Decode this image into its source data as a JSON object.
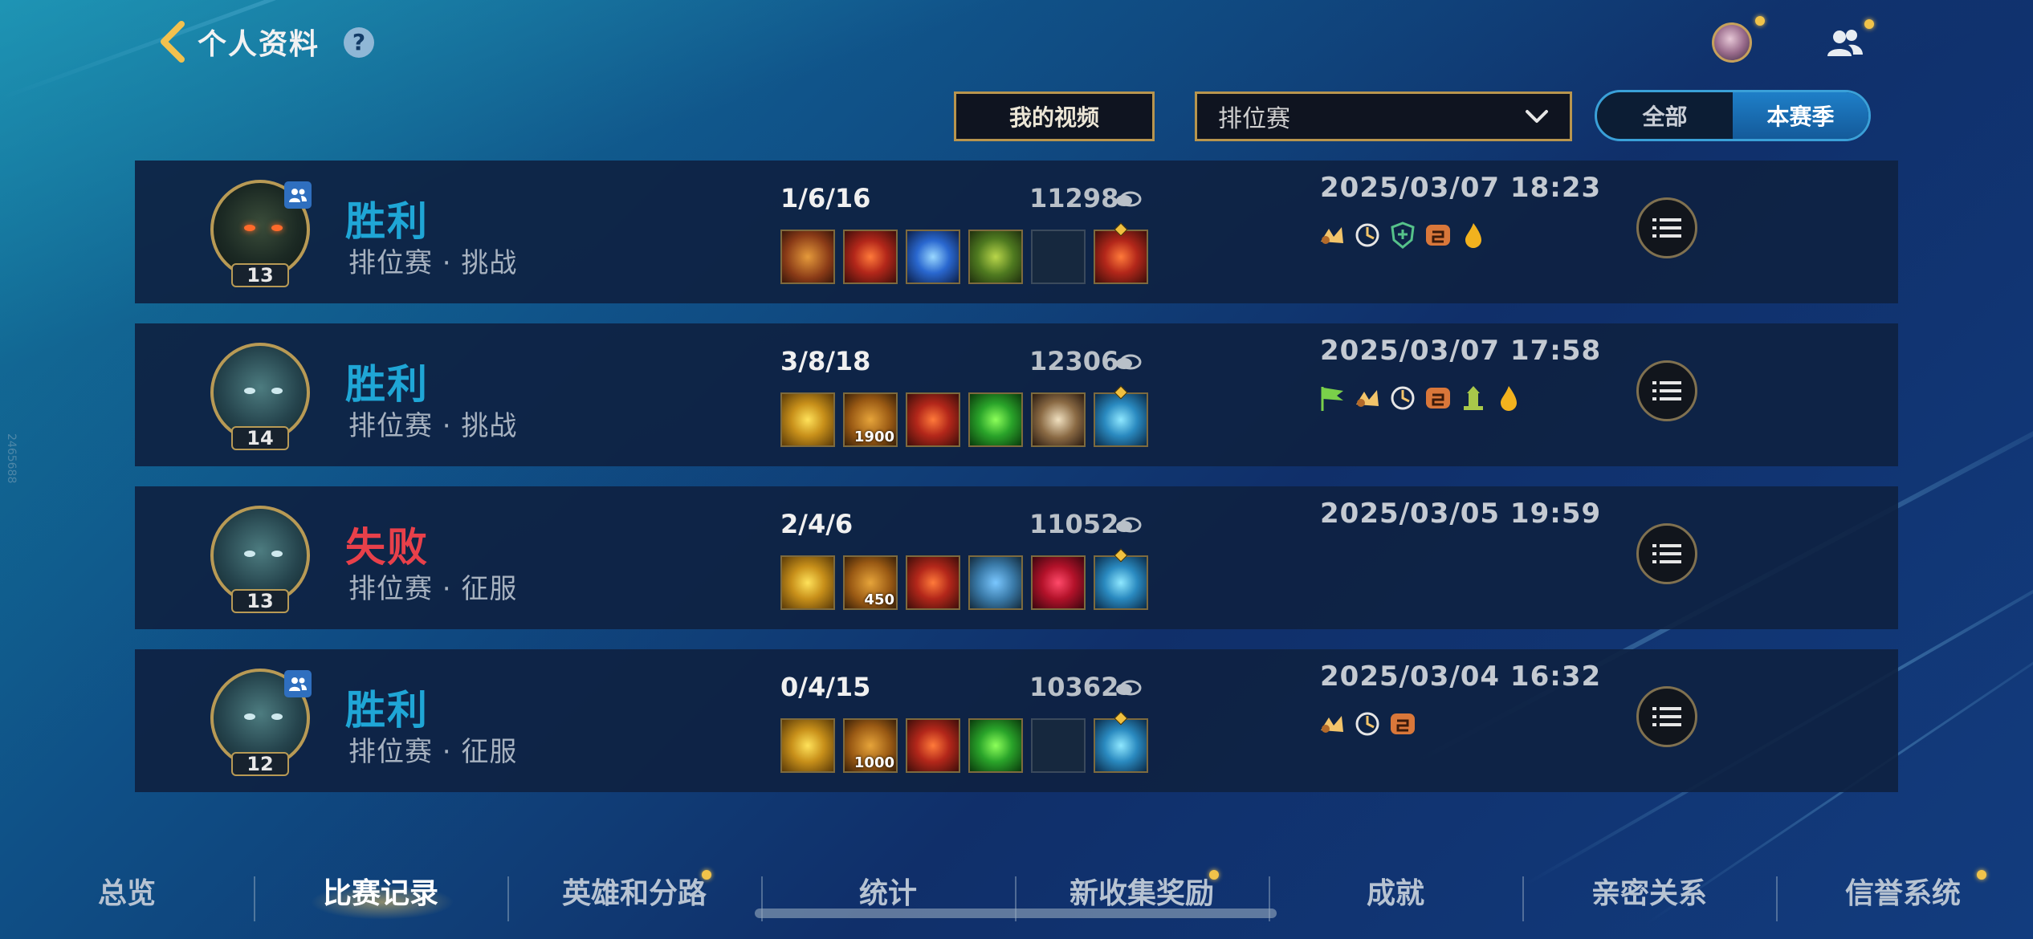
{
  "header": {
    "title": "个人资料",
    "help_icon": "?",
    "side_id": "2465688"
  },
  "filters": {
    "videos_button": "我的视频",
    "queue_selected": "排位赛",
    "season_toggle": {
      "all": "全部",
      "current": "本赛季",
      "active": "current"
    }
  },
  "matches": [
    {
      "level": "13",
      "result": "胜利",
      "result_type": "win",
      "mode": "排位赛 · 挑战",
      "kda": "1/6/16",
      "gold": "11298",
      "date": "2025/03/07 18:23",
      "party": true,
      "items": [
        {
          "icon": "orange-blade-icon",
          "count": ""
        },
        {
          "icon": "red-star-icon",
          "count": ""
        },
        {
          "icon": "blue-crystal-icon",
          "count": ""
        },
        {
          "icon": "green-mask-icon",
          "count": ""
        },
        {
          "icon": "empty-slot",
          "count": ""
        },
        {
          "icon": "red-star-trinket-icon",
          "count": ""
        }
      ],
      "badges": [
        "kill-icon",
        "assist-icon",
        "shield-icon",
        "orange-tag-icon",
        "flame-icon"
      ]
    },
    {
      "level": "14",
      "result": "胜利",
      "result_type": "win",
      "mode": "排位赛 · 挑战",
      "kda": "3/8/18",
      "gold": "12306",
      "date": "2025/03/07 17:58",
      "party": false,
      "items": [
        {
          "icon": "gold-orb-icon",
          "count": ""
        },
        {
          "icon": "map-icon",
          "count": "1900"
        },
        {
          "icon": "red-star-icon",
          "count": ""
        },
        {
          "icon": "lime-orb-icon",
          "count": ""
        },
        {
          "icon": "fist-icon",
          "count": ""
        },
        {
          "icon": "boot-trinket-icon",
          "count": ""
        }
      ],
      "badges": [
        "flag-icon",
        "kill-icon",
        "assist-icon",
        "orange-tag-icon",
        "pillar-icon",
        "flame-icon"
      ]
    },
    {
      "level": "13",
      "result": "失败",
      "result_type": "lose",
      "mode": "排位赛 · 征服",
      "kda": "2/4/6",
      "gold": "11052",
      "date": "2025/03/05 19:59",
      "party": false,
      "items": [
        {
          "icon": "gold-orb-icon",
          "count": ""
        },
        {
          "icon": "map-icon",
          "count": "450"
        },
        {
          "icon": "red-star-icon",
          "count": ""
        },
        {
          "icon": "vest-icon",
          "count": ""
        },
        {
          "icon": "ruby-icon",
          "count": ""
        },
        {
          "icon": "boot-trinket-icon",
          "count": ""
        }
      ],
      "badges": []
    },
    {
      "level": "12",
      "result": "胜利",
      "result_type": "win",
      "mode": "排位赛 · 征服",
      "kda": "0/4/15",
      "gold": "10362",
      "date": "2025/03/04 16:32",
      "party": true,
      "items": [
        {
          "icon": "gold-orb-icon",
          "count": ""
        },
        {
          "icon": "map-icon",
          "count": "1000"
        },
        {
          "icon": "red-star-icon",
          "count": ""
        },
        {
          "icon": "lime-orb-icon",
          "count": ""
        },
        {
          "icon": "empty-slot",
          "count": ""
        },
        {
          "icon": "boot-trinket-icon",
          "count": ""
        }
      ],
      "badges": [
        "kill-icon",
        "assist-icon",
        "orange-tag-icon"
      ]
    }
  ],
  "nav": {
    "tabs": [
      {
        "label": "总览",
        "active": false,
        "dot": false
      },
      {
        "label": "比赛记录",
        "active": true,
        "dot": false
      },
      {
        "label": "英雄和分路",
        "active": false,
        "dot": true
      },
      {
        "label": "统计",
        "active": false,
        "dot": false
      },
      {
        "label": "新收集奖励",
        "active": false,
        "dot": true
      },
      {
        "label": "成就",
        "active": false,
        "dot": false
      },
      {
        "label": "亲密关系",
        "active": false,
        "dot": false
      },
      {
        "label": "信誉系统",
        "active": false,
        "dot": true
      }
    ]
  },
  "colors": {
    "win": "#1fa6d6",
    "lose": "#e8404a",
    "gold_border": "#b8954e",
    "toggle_active": "#1e7fc8",
    "notify_dot": "#f1c34a"
  }
}
